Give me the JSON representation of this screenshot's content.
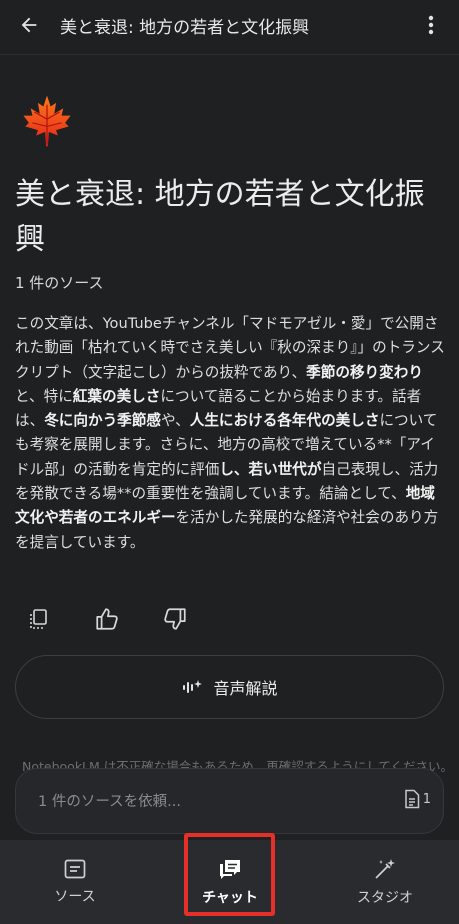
{
  "header": {
    "title": "美と衰退: 地方の若者と文化振興",
    "back_icon": "arrow-left-icon",
    "menu_icon": "more-vert-icon"
  },
  "notebook": {
    "emoji_icon": "maple-leaf-icon",
    "title": "美と衰退: 地方の若者と文化振興",
    "source_count": "1 件のソース",
    "summary": [
      {
        "text": "この文章は、YouTubeチャンネル「マドモアゼル・愛」で公開された動画「枯れていく時でさえ美しい『秋の深まり』」のトランスクリプト（文字起こし）からの抜粋であり、",
        "bold": false
      },
      {
        "text": "季節の移り変わり",
        "bold": true
      },
      {
        "text": "と、特に",
        "bold": false
      },
      {
        "text": "紅葉の美しさ",
        "bold": true
      },
      {
        "text": "について語ることから始まります。話者は、",
        "bold": false
      },
      {
        "text": "冬に向かう季節感",
        "bold": true
      },
      {
        "text": "や、",
        "bold": false
      },
      {
        "text": "人生における各年代の美しさ",
        "bold": true
      },
      {
        "text": "についても考察を展開します。さらに、地方の高校で増えている**「アイドル部」の活動を肯定的に評価",
        "bold": false
      },
      {
        "text": "し、若い世代が",
        "bold": true
      },
      {
        "text": "自己表現し、活力を発散できる場**の重要性を強調しています。結論として、",
        "bold": false
      },
      {
        "text": "地域文化や若者のエネルギー",
        "bold": true
      },
      {
        "text": "を活かした発展的な経済や社会のあり方を提言しています。",
        "bold": false
      }
    ],
    "actions": [
      "copy-notes-icon",
      "thumbs-up-icon",
      "thumbs-down-icon"
    ],
    "audio_button_label": "音声解説",
    "disclaimer": "NotebookLM は不正確な場合もあるため、再確認するようにしてください。"
  },
  "chat": {
    "placeholder": "1 件のソースを依頼...",
    "source_chip_count": "1"
  },
  "bottom_nav": {
    "items": [
      {
        "label": "ソース",
        "icon": "sources-icon",
        "active": false
      },
      {
        "label": "チャット",
        "icon": "chat-icon",
        "active": true
      },
      {
        "label": "スタジオ",
        "icon": "studio-wand-icon",
        "active": false
      }
    ]
  },
  "colors": {
    "background": "#1f2021",
    "nav_background": "#2a2b2e",
    "highlight": "#e5302a"
  }
}
